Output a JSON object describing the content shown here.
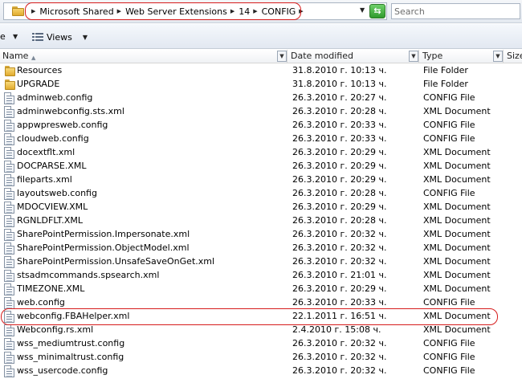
{
  "address": {
    "crumbs": [
      "Microsoft Shared",
      "Web Server Extensions",
      "14",
      "CONFIG"
    ]
  },
  "search": {
    "placeholder": "Search"
  },
  "toolbar": {
    "partial_label": "e",
    "views_label": "Views"
  },
  "columns": {
    "name": "Name",
    "date": "Date modified",
    "type": "Type",
    "size": "Size"
  },
  "files": [
    {
      "name": "Resources",
      "date": "31.8.2010 г. 10:13 ч.",
      "type": "File Folder",
      "icon": "folder-icon"
    },
    {
      "name": "UPGRADE",
      "date": "31.8.2010 г. 10:13 ч.",
      "type": "File Folder",
      "icon": "folder-icon"
    },
    {
      "name": "adminweb.config",
      "date": "26.3.2010 г. 20:27 ч.",
      "type": "CONFIG File",
      "icon": "file-icon"
    },
    {
      "name": "adminwebconfig.sts.xml",
      "date": "26.3.2010 г. 20:28 ч.",
      "type": "XML Document",
      "icon": "file-icon"
    },
    {
      "name": "appwpresweb.config",
      "date": "26.3.2010 г. 20:33 ч.",
      "type": "CONFIG File",
      "icon": "file-icon"
    },
    {
      "name": "cloudweb.config",
      "date": "26.3.2010 г. 20:33 ч.",
      "type": "CONFIG File",
      "icon": "file-icon"
    },
    {
      "name": "docextflt.xml",
      "date": "26.3.2010 г. 20:29 ч.",
      "type": "XML Document",
      "icon": "file-icon"
    },
    {
      "name": "DOCPARSE.XML",
      "date": "26.3.2010 г. 20:29 ч.",
      "type": "XML Document",
      "icon": "file-icon"
    },
    {
      "name": "fileparts.xml",
      "date": "26.3.2010 г. 20:29 ч.",
      "type": "XML Document",
      "icon": "file-icon"
    },
    {
      "name": "layoutsweb.config",
      "date": "26.3.2010 г. 20:28 ч.",
      "type": "CONFIG File",
      "icon": "file-icon"
    },
    {
      "name": "MDOCVIEW.XML",
      "date": "26.3.2010 г. 20:29 ч.",
      "type": "XML Document",
      "icon": "file-icon"
    },
    {
      "name": "RGNLDFLT.XML",
      "date": "26.3.2010 г. 20:28 ч.",
      "type": "XML Document",
      "icon": "file-icon"
    },
    {
      "name": "SharePointPermission.Impersonate.xml",
      "date": "26.3.2010 г. 20:32 ч.",
      "type": "XML Document",
      "icon": "file-icon"
    },
    {
      "name": "SharePointPermission.ObjectModel.xml",
      "date": "26.3.2010 г. 20:32 ч.",
      "type": "XML Document",
      "icon": "file-icon"
    },
    {
      "name": "SharePointPermission.UnsafeSaveOnGet.xml",
      "date": "26.3.2010 г. 20:32 ч.",
      "type": "XML Document",
      "icon": "file-icon"
    },
    {
      "name": "stsadmcommands.spsearch.xml",
      "date": "26.3.2010 г. 21:01 ч.",
      "type": "XML Document",
      "icon": "file-icon"
    },
    {
      "name": "TIMEZONE.XML",
      "date": "26.3.2010 г. 20:29 ч.",
      "type": "XML Document",
      "icon": "file-icon"
    },
    {
      "name": "web.config",
      "date": "26.3.2010 г. 20:33 ч.",
      "type": "CONFIG File",
      "icon": "file-icon"
    },
    {
      "name": "webconfig.FBAHelper.xml",
      "date": "22.1.2011 г. 16:51 ч.",
      "type": "XML Document",
      "icon": "file-icon"
    },
    {
      "name": "Webconfig.rs.xml",
      "date": "2.4.2010 г. 15:08 ч.",
      "type": "XML Document",
      "icon": "file-icon"
    },
    {
      "name": "wss_mediumtrust.config",
      "date": "26.3.2010 г. 20:32 ч.",
      "type": "CONFIG File",
      "icon": "file-icon"
    },
    {
      "name": "wss_minimaltrust.config",
      "date": "26.3.2010 г. 20:32 ч.",
      "type": "CONFIG File",
      "icon": "file-icon"
    },
    {
      "name": "wss_usercode.config",
      "date": "26.3.2010 г. 20:32 ч.",
      "type": "CONFIG File",
      "icon": "file-icon"
    }
  ],
  "colors": {
    "annotation": "#d61c1c",
    "folder": "#e1ab2e",
    "refresh": "#2f9a2c"
  }
}
